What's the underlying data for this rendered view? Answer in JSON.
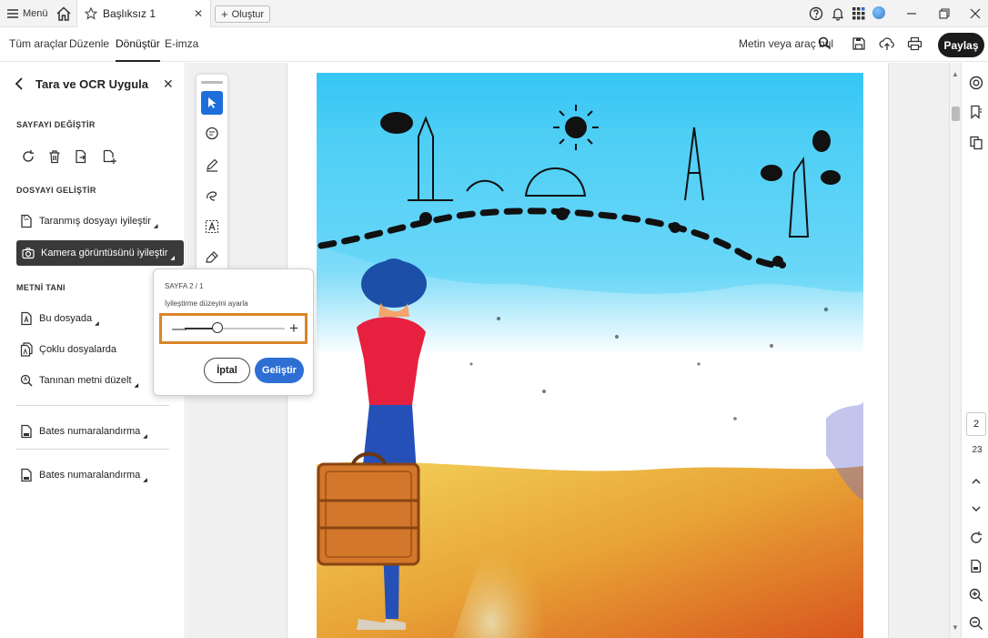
{
  "titlebar": {
    "menu_label": "Menü",
    "tab_title": "Başlıksız 1",
    "create_label": "Oluştur"
  },
  "menubar": {
    "items": [
      "Tüm araçlar",
      "Düzenle",
      "Dönüştür",
      "E-imza"
    ],
    "active_index": 2,
    "search_label": "Metin veya araç bul",
    "share_label": "Paylaş"
  },
  "panel": {
    "title": "Tara ve OCR Uygula",
    "section_page": "SAYFAYI DEĞİŞTİR",
    "section_enhance": "DOSYAYI GELİŞTİR",
    "enhance_items": [
      "Taranmış dosyayı iyileştir",
      "Kamera görüntüsünü iyileştir"
    ],
    "section_recognize": "METNİ TANI",
    "recognize_items": [
      "Bu dosyada",
      "Çoklu dosyalarda",
      "Tanınan metni düzelt"
    ],
    "bates_items": [
      "Bates numaralandırma",
      "Bates numaralandırma"
    ]
  },
  "popup": {
    "page_label": "SAYFA 2 / 1",
    "setting_label": "İyileştirme düzeyini ayarla",
    "slider_value": 0.33,
    "cancel_label": "İptal",
    "enhance_label": "Geliştir"
  },
  "navigation": {
    "current_page": "2",
    "total_pages": "23"
  },
  "colors": {
    "accent_blue": "#2f6fd4",
    "highlight_orange": "#d9862a",
    "share_button": "#1b1b1b"
  }
}
